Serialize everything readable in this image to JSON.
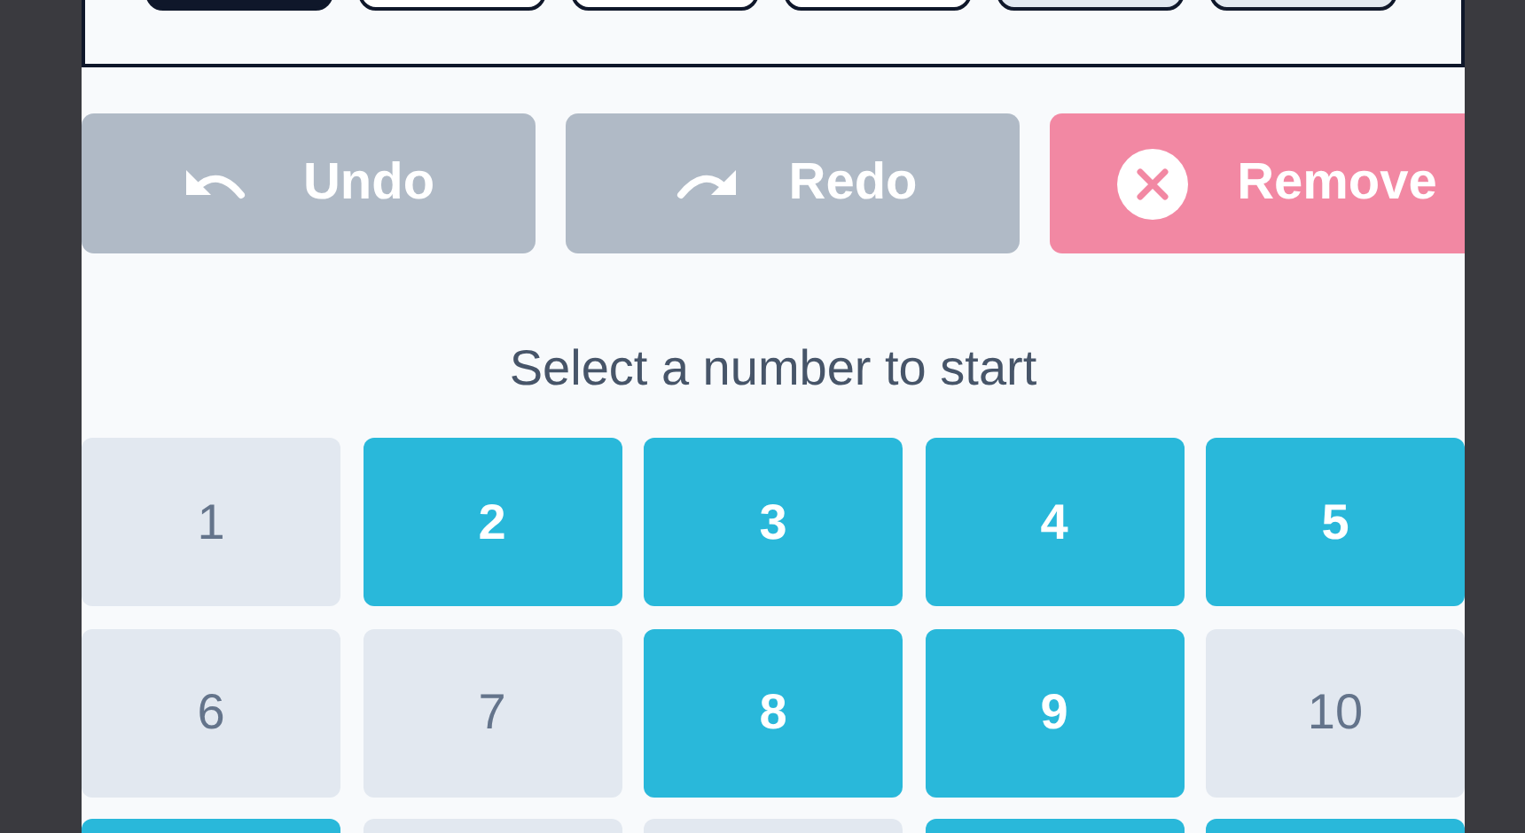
{
  "swatches": [
    {
      "color": "#0f172a"
    },
    {
      "color": "#ffffff"
    },
    {
      "color": "#ffffff"
    },
    {
      "color": "#ffffff"
    },
    {
      "color": "#e2e8f0"
    },
    {
      "color": "#e2e8f0"
    }
  ],
  "actions": [
    {
      "kind": "undo",
      "label": "Undo"
    },
    {
      "kind": "redo",
      "label": "Redo"
    },
    {
      "kind": "remove",
      "label": "Remove"
    }
  ],
  "prompt": "Select a number to start",
  "numbers": [
    {
      "label": "1",
      "selected": false
    },
    {
      "label": "2",
      "selected": true
    },
    {
      "label": "3",
      "selected": true
    },
    {
      "label": "4",
      "selected": true
    },
    {
      "label": "5",
      "selected": true
    },
    {
      "label": "6",
      "selected": false
    },
    {
      "label": "7",
      "selected": false
    },
    {
      "label": "8",
      "selected": true
    },
    {
      "label": "9",
      "selected": true
    },
    {
      "label": "10",
      "selected": false
    },
    {
      "selected": true
    },
    {
      "selected": false
    },
    {
      "selected": false
    },
    {
      "selected": true
    },
    {
      "selected": true
    }
  ]
}
